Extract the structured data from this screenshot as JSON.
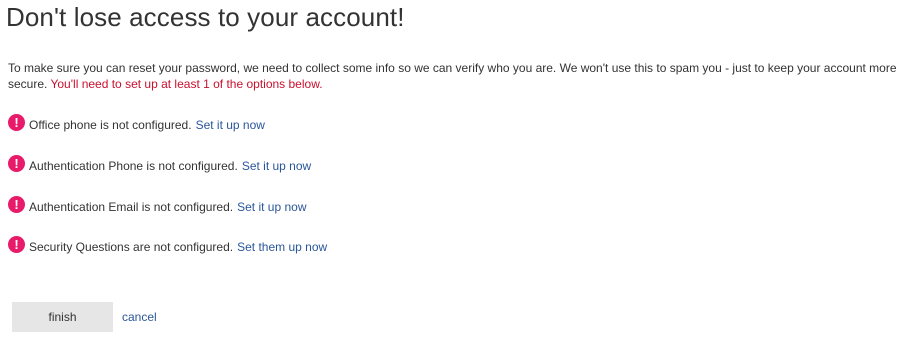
{
  "page": {
    "title": "Don't lose access to your account!",
    "intro_text": "To make sure you can reset your password, we need to collect some info so we can verify who you are. We won't use this to spam you - just to keep your account more secure.",
    "intro_warning": "You'll need to set up at least 1 of the options below."
  },
  "options": [
    {
      "icon": "exclamation-alert-icon",
      "status": "Office phone is not configured.",
      "link": "Set it up now"
    },
    {
      "icon": "exclamation-alert-icon",
      "status": "Authentication Phone is not configured.",
      "link": "Set it up now"
    },
    {
      "icon": "exclamation-alert-icon",
      "status": "Authentication Email is not configured.",
      "link": "Set it up now"
    },
    {
      "icon": "exclamation-alert-icon",
      "status": "Security Questions are not configured.",
      "link": "Set them up now"
    }
  ],
  "actions": {
    "finish_label": "finish",
    "cancel_label": "cancel"
  },
  "colors": {
    "alert_icon": "#e81b6b",
    "warning_text": "#c8102e",
    "link": "#2a5699",
    "button_bg": "#e6e6e6"
  }
}
